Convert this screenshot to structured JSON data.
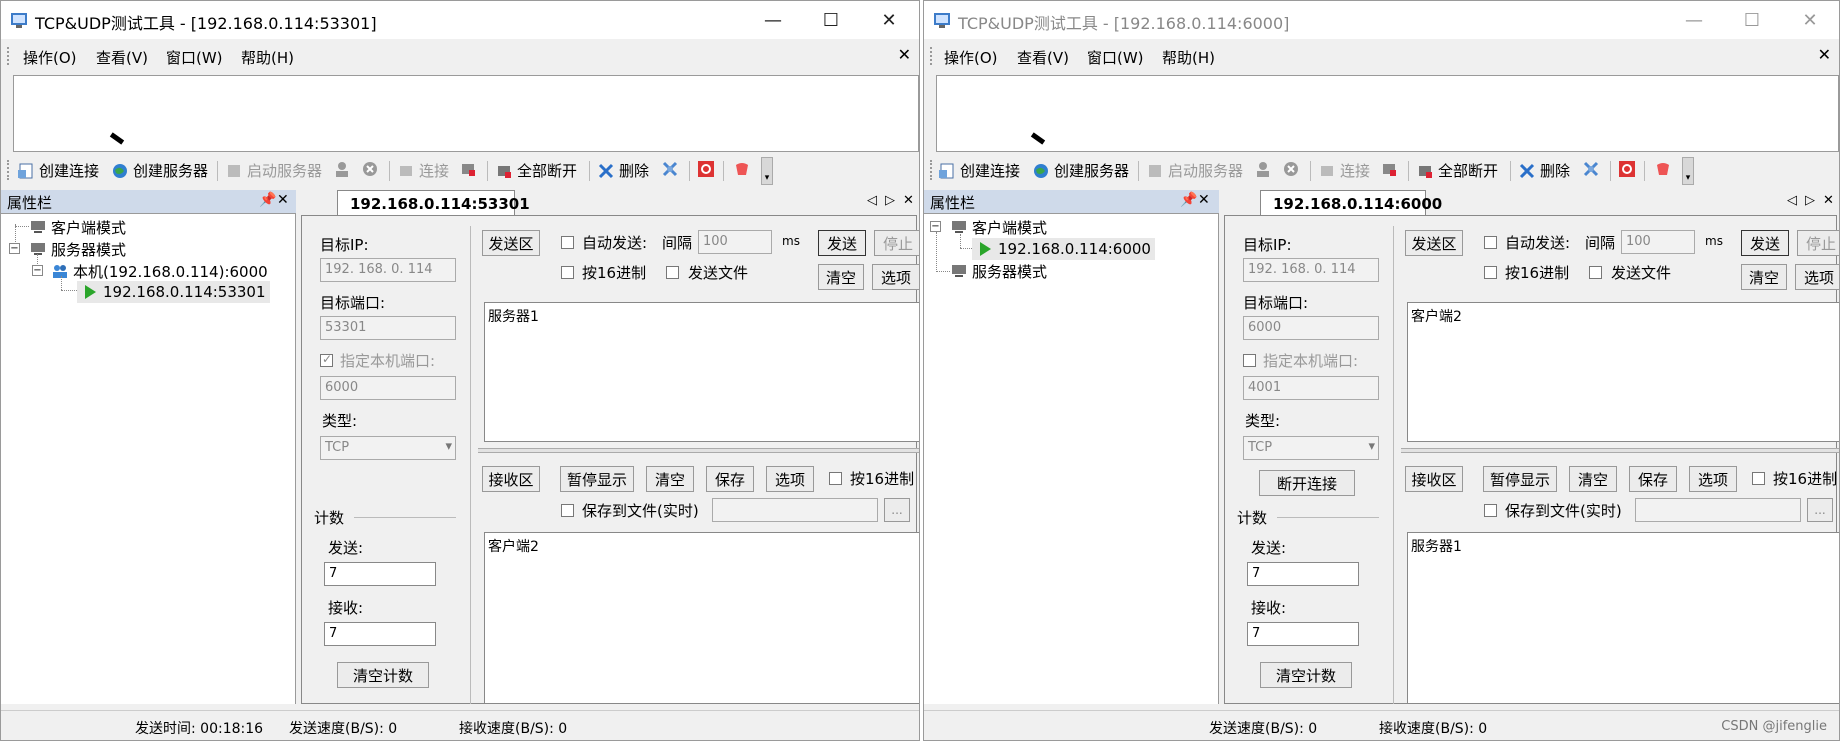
{
  "windows": [
    {
      "title": "TCP&UDP测试工具 - [192.168.0.114:53301]",
      "menu": [
        "操作(O)",
        "查看(V)",
        "窗口(W)",
        "帮助(H)"
      ],
      "toolbar": {
        "create_conn": "创建连接",
        "create_server": "创建服务器",
        "start_server": "启动服务器",
        "connect": "连接",
        "disconnect_all": "全部断开",
        "delete": "删除"
      },
      "props_title": "属性栏",
      "tree": {
        "client_mode": "客户端模式",
        "server_mode": "服务器模式",
        "local_host": "本机(192.168.0.114):6000",
        "connection": "192.168.0.114:53301"
      },
      "tab_label": "192.168.0.114:53301",
      "target_ip_label": "目标IP:",
      "target_ip": "192. 168. 0. 114",
      "target_port_label": "目标端口:",
      "target_port": "53301",
      "local_port_label": "指定本机端口:",
      "local_port": "6000",
      "type_label": "类型:",
      "type_value": "TCP",
      "count_label": "计数",
      "send_label": "发送:",
      "send_count": "7",
      "recv_label": "接收:",
      "recv_count": "7",
      "clear_count": "清空计数",
      "send_area": "发送区",
      "auto_send": "自动发送:",
      "interval_label": "间隔",
      "interval_value": "100",
      "ms": "ms",
      "send_btn": "发送",
      "stop_btn": "停止",
      "hex16": "按16进制",
      "send_file": "发送文件",
      "clear_btn": "清空",
      "options_btn": "选项",
      "send_text": "服务器1",
      "recv_area": "接收区",
      "pause_display": "暂停显示",
      "save_btn": "保存",
      "save_file": "保存到文件(实时)",
      "browse": "...",
      "recv_text": "客户端2",
      "status_send_time": "发送时间: 00:18:16",
      "status_send_speed": "发送速度(B/S): 0",
      "status_recv_speed": "接收速度(B/S): 0"
    },
    {
      "title": "TCP&UDP测试工具 - [192.168.0.114:6000]",
      "menu": [
        "操作(O)",
        "查看(V)",
        "窗口(W)",
        "帮助(H)"
      ],
      "toolbar": {
        "create_conn": "创建连接",
        "create_server": "创建服务器",
        "start_server": "启动服务器",
        "connect": "连接",
        "disconnect_all": "全部断开",
        "delete": "删除"
      },
      "props_title": "属性栏",
      "tree": {
        "client_mode": "客户端模式",
        "connection": "192.168.0.114:6000",
        "server_mode": "服务器模式"
      },
      "tab_label": "192.168.0.114:6000",
      "target_ip_label": "目标IP:",
      "target_ip": "192. 168. 0. 114",
      "target_port_label": "目标端口:",
      "target_port": "6000",
      "local_port_label": "指定本机端口:",
      "local_port": "4001",
      "type_label": "类型:",
      "type_value": "TCP",
      "disconnect_btn": "断开连接",
      "count_label": "计数",
      "send_label": "发送:",
      "send_count": "7",
      "recv_label": "接收:",
      "recv_count": "7",
      "clear_count": "清空计数",
      "send_area": "发送区",
      "auto_send": "自动发送:",
      "interval_label": "间隔",
      "interval_value": "100",
      "ms": "ms",
      "send_btn": "发送",
      "stop_btn": "停止",
      "hex16": "按16进制",
      "send_file": "发送文件",
      "clear_btn": "清空",
      "options_btn": "选项",
      "send_text": "客户端2",
      "recv_area": "接收区",
      "pause_display": "暂停显示",
      "save_btn": "保存",
      "save_file": "保存到文件(实时)",
      "browse": "...",
      "recv_text": "服务器1",
      "status_send_speed": "发送速度(B/S): 0",
      "status_recv_speed": "接收速度(B/S): 0"
    }
  ],
  "watermark": "CSDN @jifenglie",
  "colors": {
    "panel_bg": "#f0f0f0",
    "props_header": "#cfdaea",
    "play_icon": "#2aa52a"
  },
  "icons": [
    "app-icon",
    "minimize-icon",
    "maximize-icon",
    "close-icon",
    "play-icon",
    "computer-icon",
    "users-icon"
  ]
}
